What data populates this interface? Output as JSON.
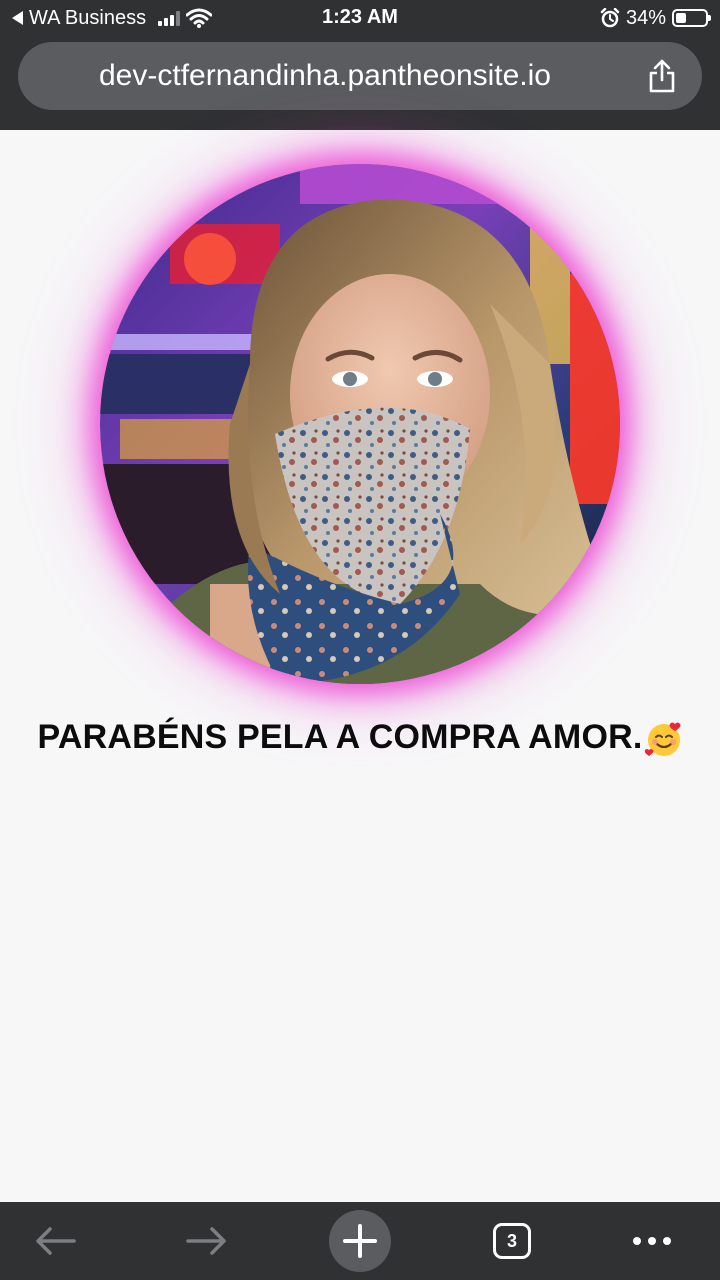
{
  "status_bar": {
    "back_app_label": "WA Business",
    "time": "1:23 AM",
    "battery_percent_text": "34%",
    "battery_level": 0.34,
    "icons": [
      "back-triangle-icon",
      "cellular-signal-icon",
      "wifi-icon",
      "alarm-icon",
      "battery-icon"
    ]
  },
  "browser": {
    "url": "dev-ctfernandinha.pantheonsite.io",
    "share_icon": "share-icon"
  },
  "page": {
    "profile_photo_icon": "profile-photo",
    "headline": "PARABÉNS PELA A COMPRA AMOR.",
    "headline_emoji_icon": "smiling-face-with-hearts-icon",
    "glow_color": "#ec40d2"
  },
  "toolbar": {
    "back_icon": "arrow-left-icon",
    "forward_icon": "arrow-right-icon",
    "new_tab_icon": "plus-icon",
    "tab_count": "3",
    "more_icon": "more-dots-icon"
  }
}
